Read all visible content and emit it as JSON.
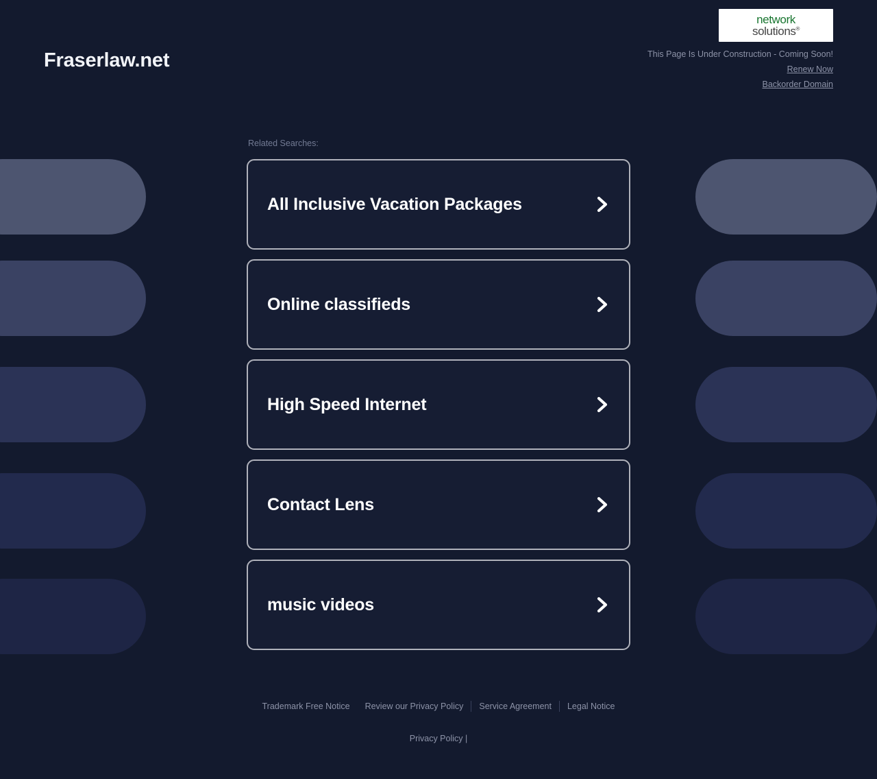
{
  "header": {
    "site_title": "Fraserlaw.net",
    "logo": {
      "line1": "network",
      "line2": "solutions",
      "registered_mark": "®",
      "green": "#18752f",
      "gray": "#444444"
    },
    "notice": "This Page Is Under Construction - Coming Soon!",
    "renew_link": "Renew Now",
    "backorder_link": "Backorder Domain"
  },
  "main": {
    "related_label": "Related Searches:",
    "results": [
      {
        "label": "All Inclusive Vacation Packages"
      },
      {
        "label": "Online classifieds"
      },
      {
        "label": "High Speed Internet"
      },
      {
        "label": "Contact Lens"
      },
      {
        "label": "music videos"
      }
    ]
  },
  "footer": {
    "links": [
      {
        "label": "Trademark Free Notice"
      },
      {
        "label": "Review our Privacy Policy"
      },
      {
        "label": "Service Agreement"
      },
      {
        "label": "Legal Notice"
      }
    ],
    "bottom_text": "Privacy Policy |"
  },
  "theme": {
    "background": "#131a2e",
    "card_background": "#161d33",
    "card_border": "#b0b2bb",
    "text_primary": "#ffffff",
    "text_muted": "#8d93a8",
    "pill_colors": [
      "#4d5570",
      "#3a4263",
      "#2b3356",
      "#222a4d",
      "#1e2545"
    ]
  }
}
